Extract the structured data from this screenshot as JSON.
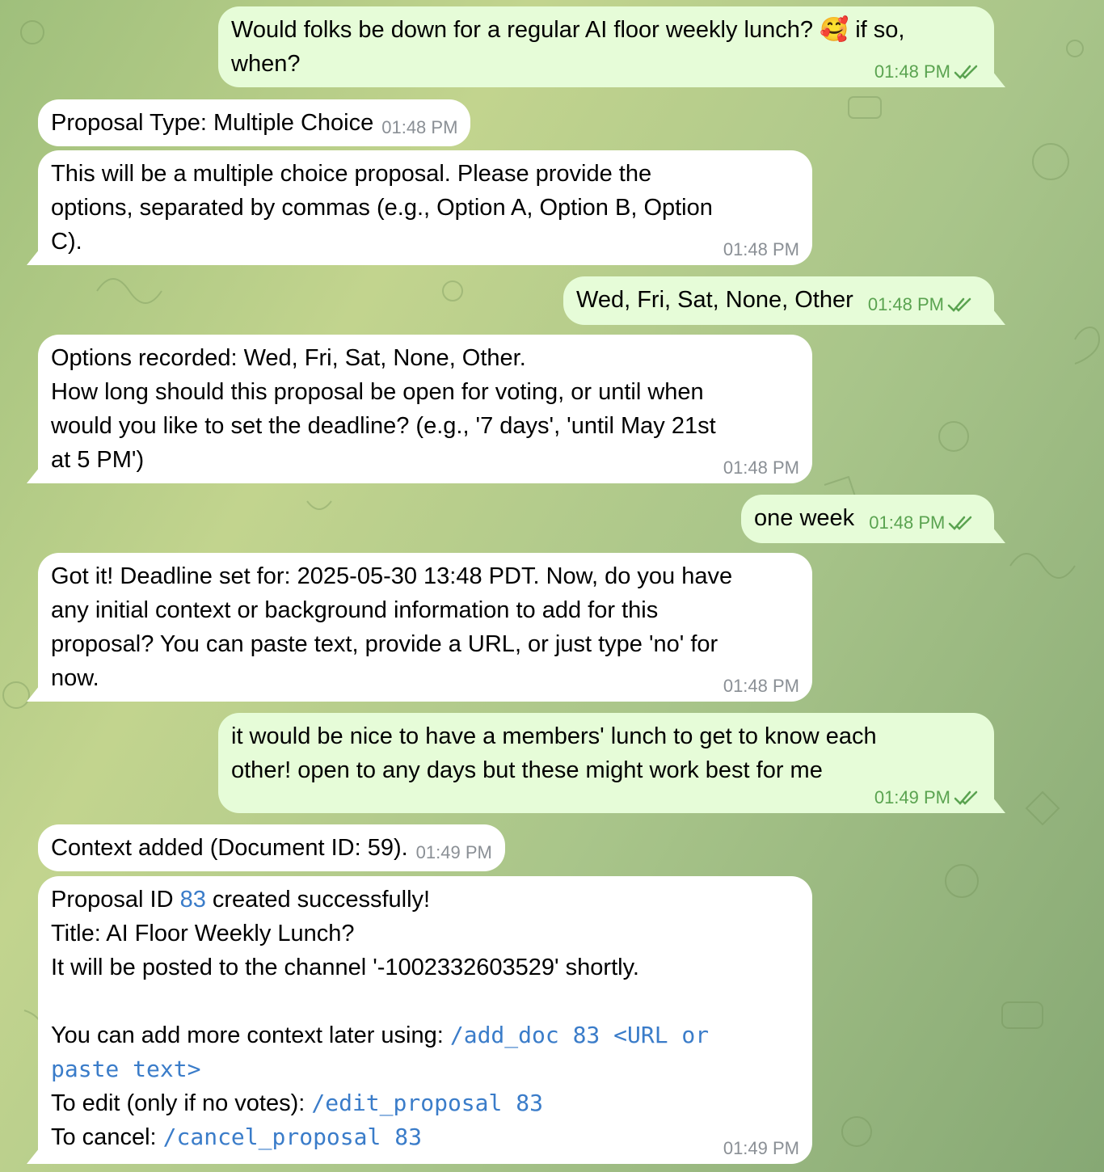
{
  "colors": {
    "incoming": "#ffffff",
    "outgoing": "#e6fcd8",
    "time_in": "#8a8f95",
    "time_out": "#5aa350",
    "link": "#3a7cc9"
  },
  "messages": [
    {
      "dir": "out",
      "lines": [
        "Would folks be down for a regular AI floor weekly lunch? 🥰 if so,",
        "when?"
      ],
      "time": "01:48 PM"
    },
    {
      "dir": "in",
      "text": "Proposal Type: Multiple Choice",
      "time": "01:48 PM"
    },
    {
      "dir": "in",
      "lines": [
        "This will be a multiple choice proposal. Please provide the",
        "options, separated by commas (e.g., Option A, Option B, Option",
        "C)."
      ],
      "time": "01:48 PM"
    },
    {
      "dir": "out",
      "text": "Wed, Fri, Sat, None, Other",
      "time": "01:48 PM"
    },
    {
      "dir": "in",
      "lines": [
        "Options recorded: Wed, Fri, Sat, None, Other.",
        "How long should this proposal be open for voting, or until when",
        "would you like to set the deadline? (e.g., '7 days', 'until May 21st",
        "at 5 PM')"
      ],
      "time": "01:48 PM"
    },
    {
      "dir": "out",
      "text": "one week",
      "time": "01:48 PM"
    },
    {
      "dir": "in",
      "lines": [
        "Got it! Deadline set for: 2025-05-30 13:48 PDT. Now, do you have",
        "any initial context or background information to add for this",
        "proposal? You can paste text, provide a URL, or just type 'no' for",
        "now."
      ],
      "time": "01:48 PM"
    },
    {
      "dir": "out",
      "lines": [
        "it would be nice to have a members' lunch to get to know each",
        "other! open to any days but these might work best for me"
      ],
      "time": "01:49 PM"
    },
    {
      "dir": "in",
      "text": "Context added (Document ID: 59).",
      "time": "01:49 PM"
    },
    {
      "dir": "in",
      "time": "01:49 PM",
      "line1_pre": "Proposal ID ",
      "line1_id": "83",
      "line1_post": " created successfully!",
      "line2": "Title: AI Floor Weekly Lunch?",
      "line3": "It will be posted to the channel '-1002332603529' shortly.",
      "line4_pre": "You can add more context later using: ",
      "line4_cmd_a": "/add_doc 83 <URL or",
      "line4_cmd_b": "paste text>",
      "line5_pre": "To edit (only if no votes): ",
      "line5_cmd": "/edit_proposal 83",
      "line6_pre": "To cancel: ",
      "line6_cmd": "/cancel_proposal 83"
    }
  ]
}
